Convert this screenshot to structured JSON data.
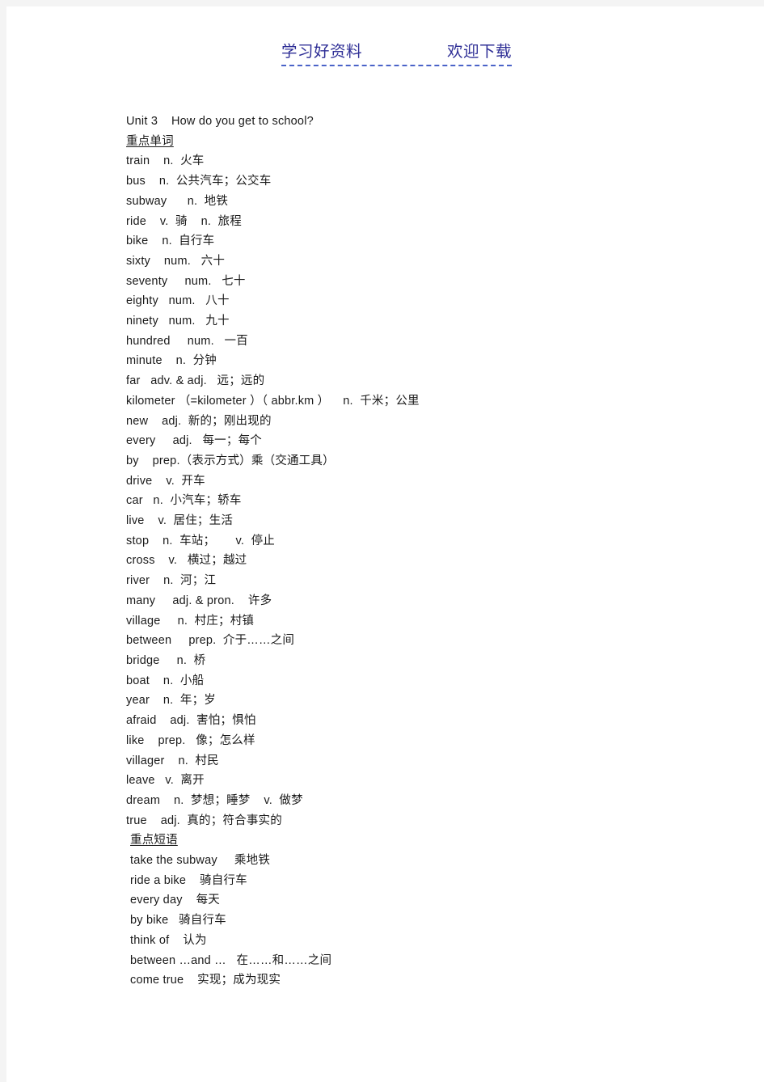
{
  "header": {
    "left": "学习好资料",
    "right": "欢迎下载"
  },
  "document": {
    "title": "Unit 3    How do you get to school?",
    "sections": [
      {
        "heading": "重点单词",
        "entries": [
          "train    n.  火车",
          "bus    n.  公共汽车；公交车",
          "subway      n.  地铁",
          "ride    v.  骑    n.  旅程",
          "bike    n.  自行车",
          "sixty    num.   六十",
          "seventy     num.   七十",
          "eighty   num.   八十",
          "ninety   num.   九十",
          "hundred     num.   一百",
          "minute    n.  分钟",
          "far   adv. & adj.   远；远的",
          "kilometer （=kilometer ）（ abbr.km ）    n.  千米；公里",
          "new    adj.  新的；刚出现的",
          "every     adj.   每一；每个",
          "by    prep.（表示方式）乘（交通工具）",
          "drive    v.  开车",
          "car   n.  小汽车；轿车",
          "live    v.  居住；生活",
          "stop    n.  车站；      v.  停止",
          "cross    v.   横过；越过",
          "river    n.  河；江",
          "many     adj. & pron.    许多",
          "village     n.  村庄；村镇",
          "between     prep.  介于……之间",
          "bridge     n.  桥",
          "boat    n.  小船",
          "year    n.  年；岁",
          "afraid    adj.  害怕；惧怕",
          "like    prep.   像；怎么样",
          "villager    n.  村民",
          "leave   v.  离开",
          "dream    n.  梦想；睡梦    v.  做梦",
          "true    adj.  真的；符合事实的"
        ]
      },
      {
        "heading": "重点短语",
        "entries": [
          "take the subway     乘地铁",
          "ride a bike    骑自行车",
          "every day    每天",
          "by bike   骑自行车",
          "think of    认为",
          "between …and …   在……和……之间",
          "come true    实现；成为现实"
        ]
      }
    ]
  }
}
